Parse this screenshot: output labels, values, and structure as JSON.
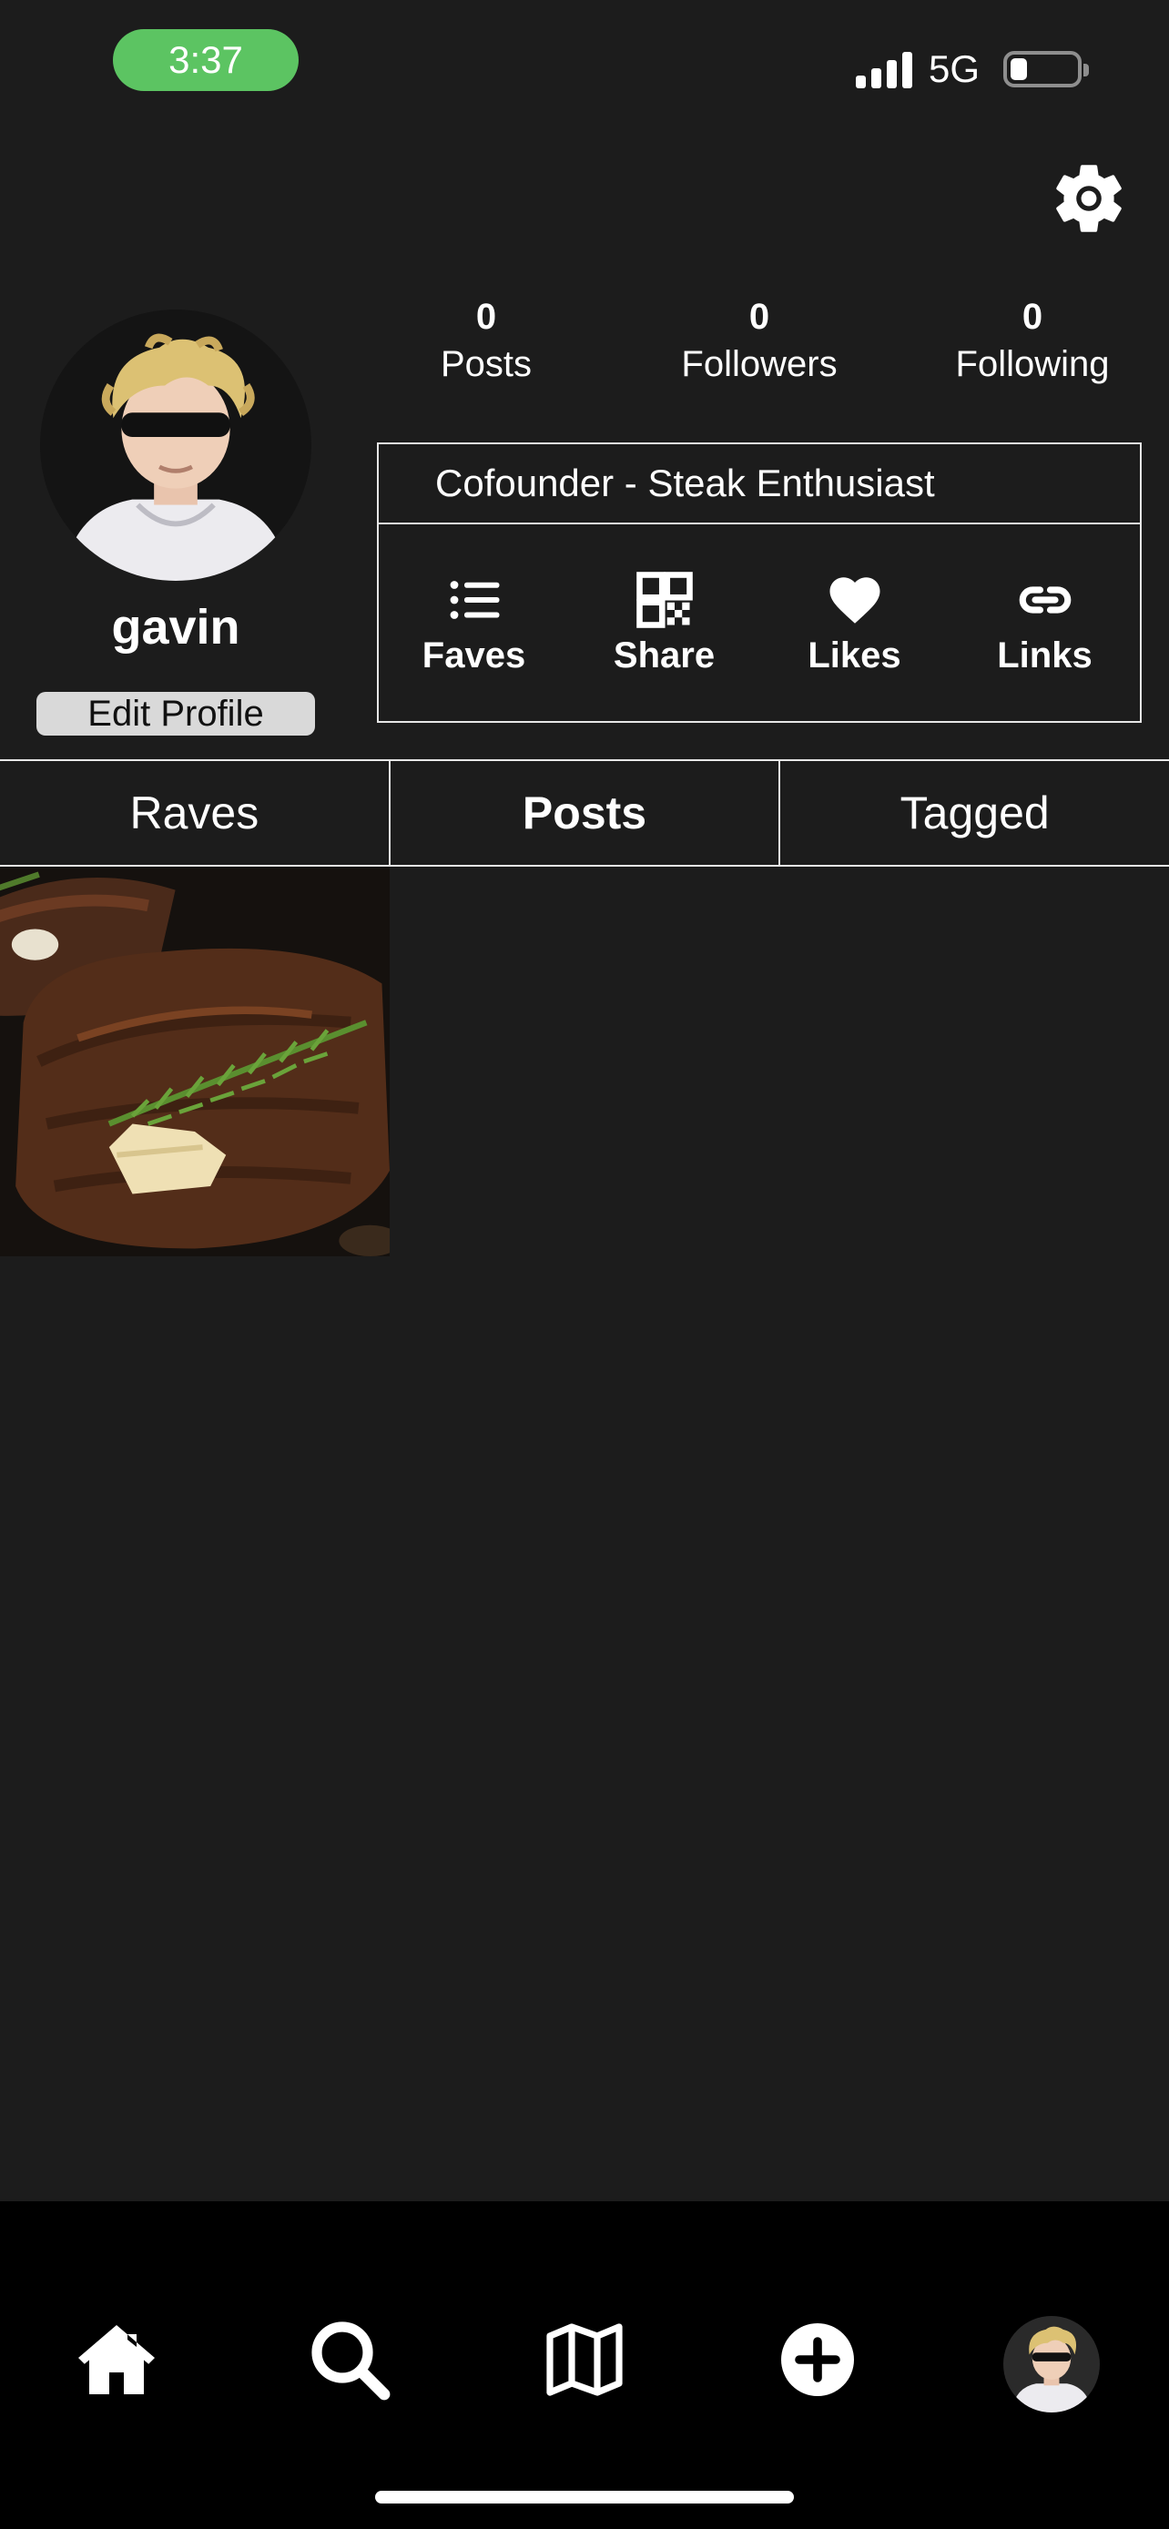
{
  "status_bar": {
    "time": "3:37",
    "network": "5G",
    "battery_level": 0.25,
    "signal_bars": 4
  },
  "colors": {
    "background": "#1c1c1c",
    "time_pill": "#5cc462",
    "bottom_nav": "#000000",
    "border": "#e6e6e6",
    "edit_button": "#d9d9d9"
  },
  "profile": {
    "username": "gavin",
    "edit_label": "Edit Profile",
    "bio": "Cofounder - Steak Enthusiast"
  },
  "stats": [
    {
      "value": "0",
      "label": "Posts"
    },
    {
      "value": "0",
      "label": "Followers"
    },
    {
      "value": "0",
      "label": "Following"
    }
  ],
  "actions": [
    {
      "label": "Faves",
      "icon": "list-icon"
    },
    {
      "label": "Share",
      "icon": "qr-code-icon"
    },
    {
      "label": "Likes",
      "icon": "heart-icon"
    },
    {
      "label": "Links",
      "icon": "link-icon"
    }
  ],
  "tabs": [
    {
      "label": "Raves",
      "active": false
    },
    {
      "label": "Posts",
      "active": true
    },
    {
      "label": "Tagged",
      "active": false
    }
  ],
  "posts": [
    {
      "image": "steak-with-rosemary-and-butter"
    }
  ],
  "bottom_nav": [
    {
      "icon": "home-icon"
    },
    {
      "icon": "search-icon"
    },
    {
      "icon": "map-icon"
    },
    {
      "icon": "add-icon"
    },
    {
      "icon": "profile-avatar"
    }
  ]
}
